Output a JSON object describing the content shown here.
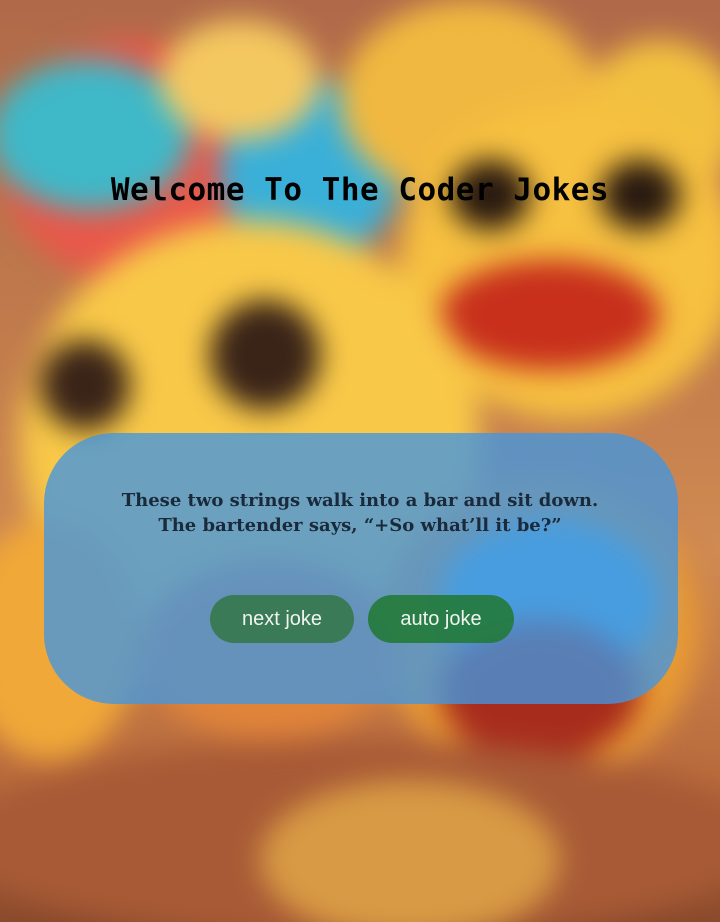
{
  "page": {
    "title": "Welcome To The Coder Jokes"
  },
  "joke": {
    "text": "These two strings walk into a bar and sit down. The bartender says, “+So what’ll it be?”"
  },
  "buttons": {
    "next_label": "next joke",
    "auto_label": "auto joke"
  },
  "colors": {
    "card": "#4296e0",
    "button": "#2f7a46",
    "title": "#000000"
  },
  "background": {
    "icon": "smiley-emoji-crowd"
  }
}
